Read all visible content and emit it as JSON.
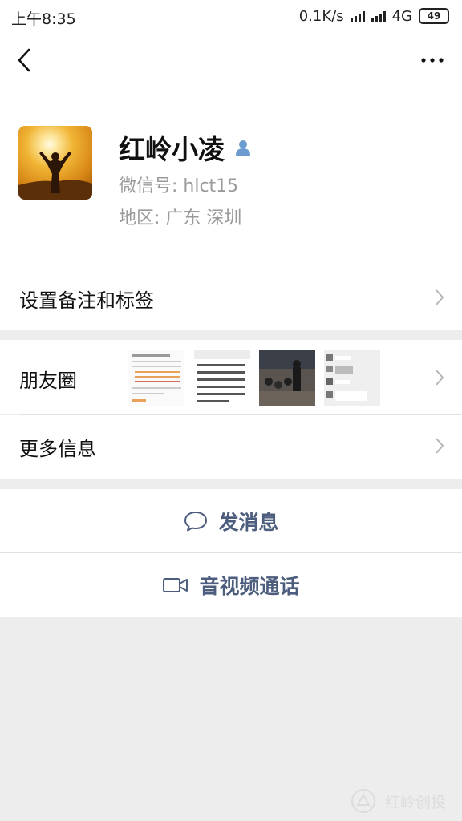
{
  "status_bar": {
    "time": "上午8:35",
    "network_speed": "0.1K/s",
    "network_type": "4G",
    "battery": "49"
  },
  "nav": {
    "back_icon": "chevron-left-icon",
    "more_icon": "more-dots-icon"
  },
  "profile": {
    "name": "红岭小凌",
    "wechat_id": "微信号:  hlct15",
    "region": "地区:  广东  深圳",
    "verified_icon": "person-icon"
  },
  "menu": {
    "remark_tags": "设置备注和标签",
    "moments": "朋友圈",
    "more_info": "更多信息"
  },
  "actions": {
    "send_message": "发消息",
    "video_call": "音视频通话"
  },
  "moments_thumbnails": [
    {
      "type": "document-screenshot"
    },
    {
      "type": "text-screenshot",
      "snippet": "如何应对传销受害..."
    },
    {
      "type": "photo-meeting"
    },
    {
      "type": "chat-screenshot"
    }
  ],
  "watermark": {
    "text": "红岭创投"
  },
  "colors": {
    "action_text": "#4c5d7d",
    "secondary_text": "#9a9a9a",
    "background": "#ededed"
  }
}
